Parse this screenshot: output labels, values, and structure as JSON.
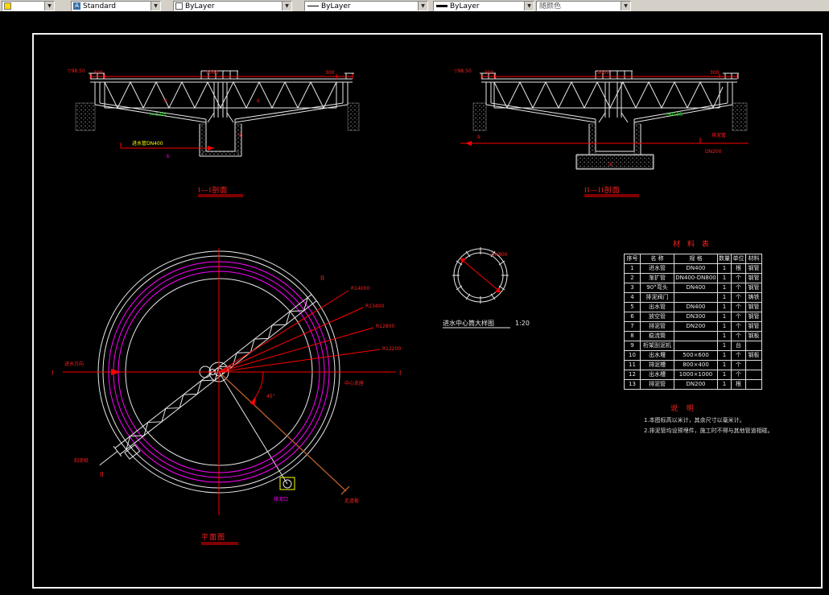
{
  "toolbar": {
    "text_style": "Standard",
    "color": "ByLayer",
    "linetype": "ByLayer",
    "lineweight": "ByLayer",
    "plot_style": "随颜色"
  },
  "section1": {
    "title": "I—I剖面",
    "dim_left": "300",
    "dim_mid": "9000",
    "dim_right": "300",
    "elev": "▽98.50",
    "slope": "i=0.05",
    "pipe_label": "进水管DN400",
    "balloon1": "④",
    "balloon2": "⑤",
    "balloon3": "⑥",
    "balloon4": "①"
  },
  "section2": {
    "title": "II—II剖面",
    "dim_left": "300",
    "dim_mid": "9000",
    "dim_right": "300",
    "elev": "▽98.50",
    "slope": "i=0.05",
    "pipe_label": "排泥管",
    "pipe_spec": "DN200",
    "balloon1": "②",
    "balloon2": "⑧"
  },
  "plan": {
    "title": "平面图",
    "flow_label": "进水方向",
    "center_label": "中心支座",
    "angle_label": "45°",
    "marker_left": "I",
    "marker_right": "I",
    "marker_top": "II",
    "marker_bottom": "II",
    "fan": [
      "R14000",
      "R13400",
      "R12800",
      "R12200"
    ],
    "scraper_label": "刮泥机",
    "sludge_label": "排泥口",
    "walkway_label": "走道板"
  },
  "detail": {
    "title": "进水中心筒大样图",
    "scale": "1:20",
    "dim": "DN800"
  },
  "table": {
    "title": "材 料 表",
    "headers": [
      "序号",
      "名 称",
      "规 格",
      "数量",
      "单位",
      "材料"
    ],
    "rows": [
      [
        "1",
        "进水管",
        "DN400",
        "1",
        "根",
        "钢管"
      ],
      [
        "2",
        "渐扩管",
        "DN400-DN800",
        "1",
        "个",
        "钢管"
      ],
      [
        "3",
        "90°弯头",
        "DN400",
        "1",
        "个",
        "钢管"
      ],
      [
        "4",
        "排泥阀门",
        "",
        "1",
        "个",
        "铸铁"
      ],
      [
        "5",
        "出水管",
        "DN400",
        "1",
        "个",
        "钢管"
      ],
      [
        "6",
        "放空管",
        "DN300",
        "1",
        "个",
        "钢管"
      ],
      [
        "7",
        "排泥管",
        "DN200",
        "1",
        "个",
        "钢管"
      ],
      [
        "8",
        "稳流筒",
        "",
        "1",
        "个",
        "钢板"
      ],
      [
        "9",
        "桁架刮泥机",
        "",
        "1",
        "台",
        ""
      ],
      [
        "10",
        "出水堰",
        "500×600",
        "1",
        "个",
        "钢板"
      ],
      [
        "11",
        "排泥槽",
        "800×400",
        "1",
        "个",
        ""
      ],
      [
        "12",
        "出水槽",
        "1000×1000",
        "1",
        "个",
        ""
      ],
      [
        "13",
        "排泥管",
        "DN200",
        "1",
        "根",
        ""
      ]
    ]
  },
  "notes": {
    "title": "说 明",
    "lines": [
      "1.本图标高以米计，其余尺寸以毫米计。",
      "2.排泥管均设预埋件，施工时不得与其他管道相碰。"
    ]
  }
}
